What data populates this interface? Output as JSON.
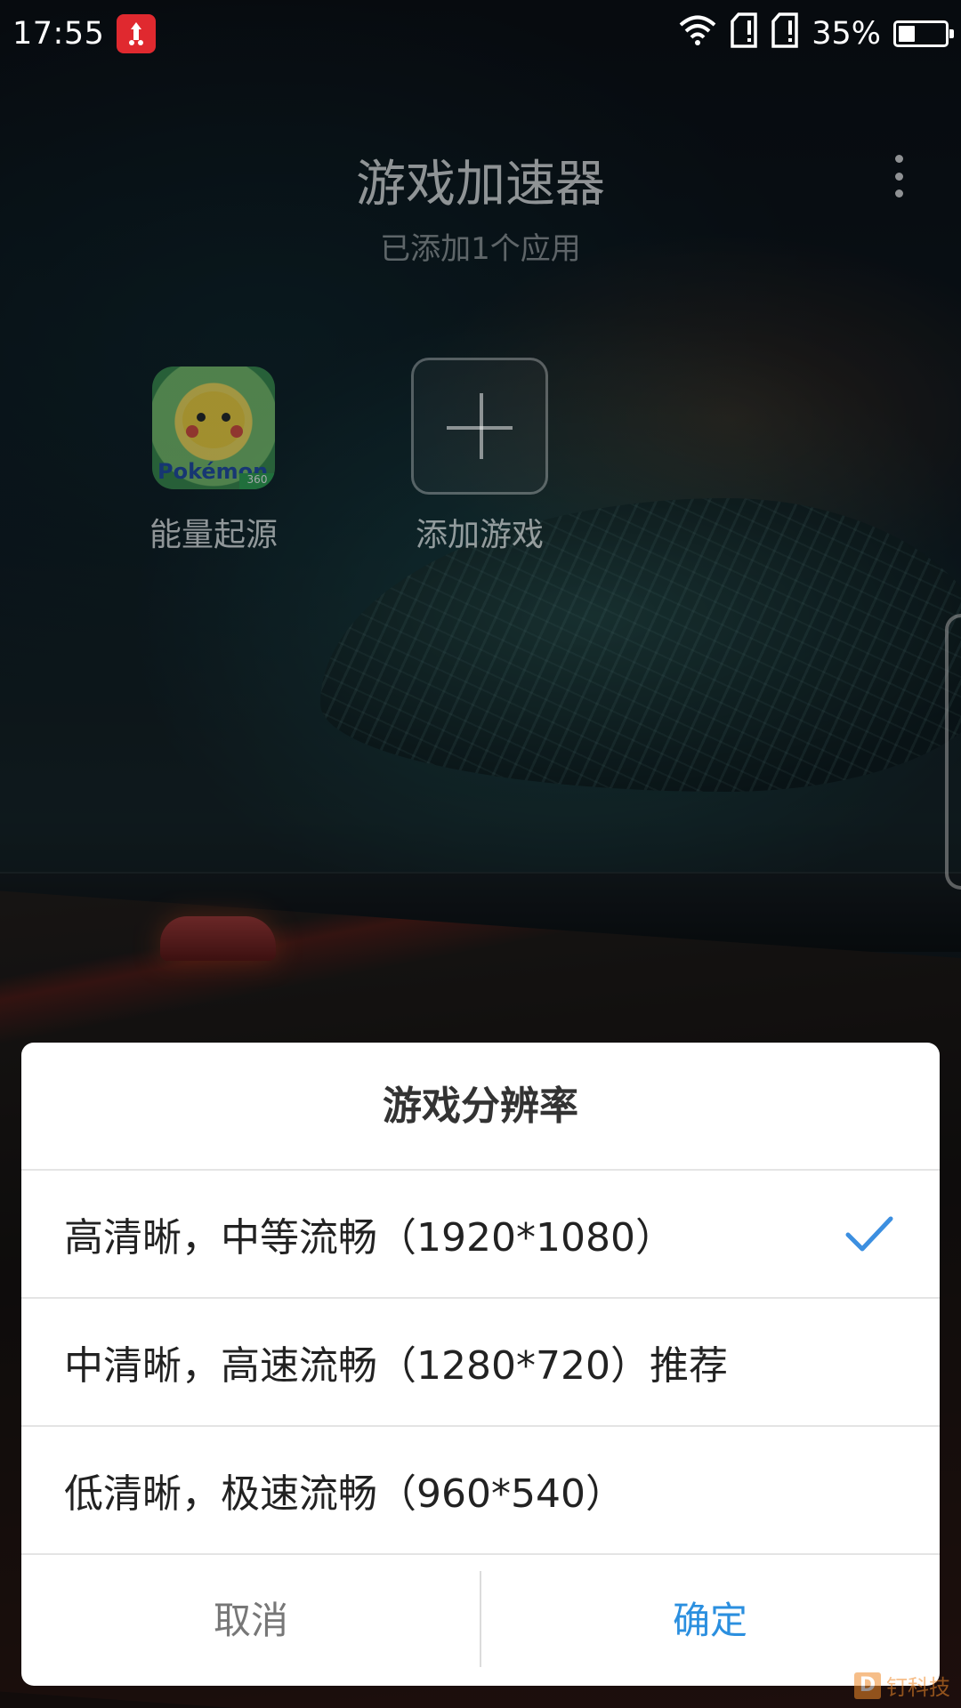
{
  "status_bar": {
    "time": "17:55",
    "battery_percent": "35%",
    "battery_level": 0.35,
    "icons": [
      "app-badge-icon",
      "wifi-icon",
      "sim1-icon",
      "sim2-icon",
      "battery-icon"
    ]
  },
  "header": {
    "title": "游戏加速器",
    "subtitle": "已添加1个应用",
    "menu_icon": "more-vertical-icon"
  },
  "apps": [
    {
      "label": "能量起源",
      "icon": "game-icon",
      "icon_text": "Pokémon",
      "icon_badge": "360"
    },
    {
      "label": "添加游戏",
      "icon": "plus-icon"
    }
  ],
  "dialog": {
    "title": "游戏分辨率",
    "options": [
      {
        "label": "高清晰，中等流畅（1920*1080）",
        "selected": true
      },
      {
        "label": "中清晰，高速流畅（1280*720）推荐",
        "selected": false
      },
      {
        "label": "低清晰，极速流畅（960*540）",
        "selected": false
      }
    ],
    "cancel_label": "取消",
    "confirm_label": "确定"
  },
  "colors": {
    "accent": "#2b8fdf",
    "check": "#3c8fe0",
    "dialog_bg": "#ffffff",
    "watermark": "#f08a2a"
  },
  "watermark": {
    "logo": "D",
    "text": "钉科技"
  }
}
